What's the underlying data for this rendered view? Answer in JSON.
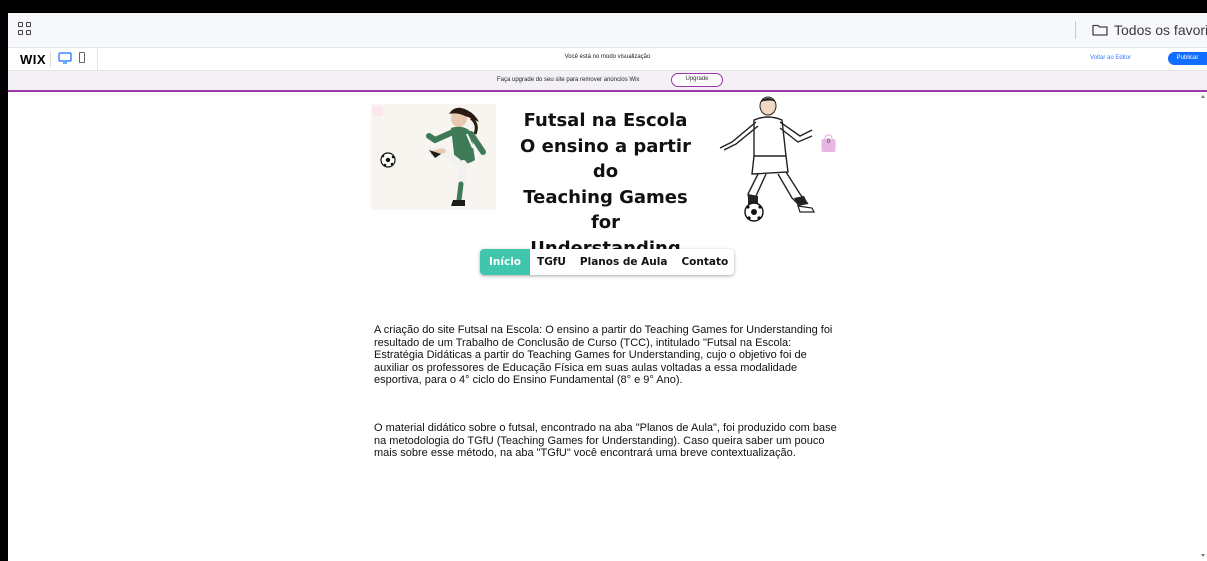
{
  "browser": {
    "bookmark_folder_label": "Todos os favoritos",
    "apps_icon": "apps-grid-icon",
    "folder_icon": "folder-icon"
  },
  "wix_bar": {
    "logo": "WIX",
    "preview_message": "Você está no modo visualização",
    "back_to_editor": "Voltar ao Editor",
    "publish": "Publicar"
  },
  "upgrade_bar": {
    "message": "Faça upgrade do seu site para remover anúncios Wix",
    "button": "Upgrade"
  },
  "site": {
    "title_lines": [
      "Futsal na Escola",
      "O ensino a partir do",
      "Teaching Games for",
      "Understanding"
    ],
    "cart_count": "0",
    "nav": [
      {
        "label": "Início",
        "active": true
      },
      {
        "label": "TGfU",
        "active": false
      },
      {
        "label": "Planos de Aula",
        "active": false
      },
      {
        "label": "Contato",
        "active": false
      }
    ],
    "paragraph_1": "A criação do site Futsal na Escola: O ensino a partir do Teaching Games for Understanding foi resultado de um Trabalho de Conclusão de Curso (TCC), intitulado \"Futsal na Escola: Estratégia Didáticas a partir do Teaching Games for Understanding, cujo o objetivo foi de auxiliar os professores de Educação Física em suas aulas voltadas a essa modalidade esportiva, para o 4° ciclo do Ensino Fundamental (8° e 9° Ano).",
    "paragraph_2": "O material didático sobre o futsal, encontrado na aba \"Planos de Aula\", foi produzido com base na metodologia do TGfU (Teaching Games for Understanding). Caso queira saber um pouco mais sobre esse método, na aba \"TGfU\" você encontrará uma breve contextualização."
  },
  "colors": {
    "nav_active": "#3fc6ac",
    "upgrade_accent": "#9a3aa8",
    "publish_blue": "#116dff",
    "cart_pink": "#e7b6e3"
  }
}
